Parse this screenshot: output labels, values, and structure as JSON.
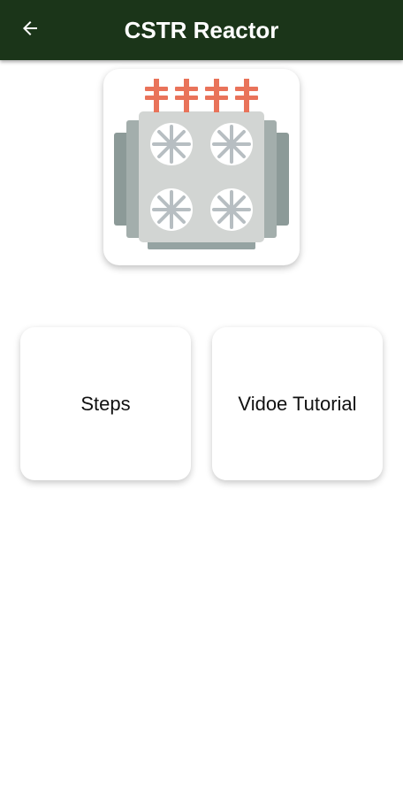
{
  "appbar": {
    "title": "CSTR Reactor",
    "back_icon": "arrow-left-icon",
    "background_color": "#1b3519"
  },
  "hero": {
    "icon": "reactor-icon"
  },
  "menu": {
    "items": [
      {
        "label": "Steps"
      },
      {
        "label": "Vidoe Tutorial"
      }
    ]
  }
}
